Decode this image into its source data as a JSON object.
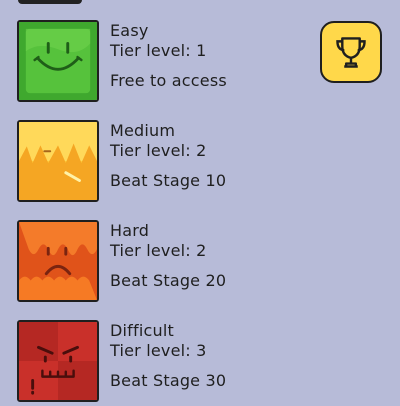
{
  "tiers": [
    {
      "name": "Easy",
      "level": "Tier level: 1",
      "requirement": "Free to access",
      "card_icon": "smiley-face-icon",
      "color": "#3fa82e"
    },
    {
      "name": "Medium",
      "level": "Tier level: 2",
      "requirement": "Beat Stage 10",
      "card_icon": "flat-face-icon",
      "color": "#ffc93a"
    },
    {
      "name": "Hard",
      "level": "Tier level: 2",
      "requirement": "Beat Stage 20",
      "card_icon": "frown-face-icon",
      "color": "#f06a1c"
    },
    {
      "name": "Difficult",
      "level": "Tier level: 3",
      "requirement": "Beat Stage 30",
      "card_icon": "angry-face-icon",
      "color": "#c9302a"
    }
  ],
  "trophy": {
    "icon": "trophy-icon",
    "color": "#ffd84a"
  },
  "background_color": "#b7bbd8"
}
